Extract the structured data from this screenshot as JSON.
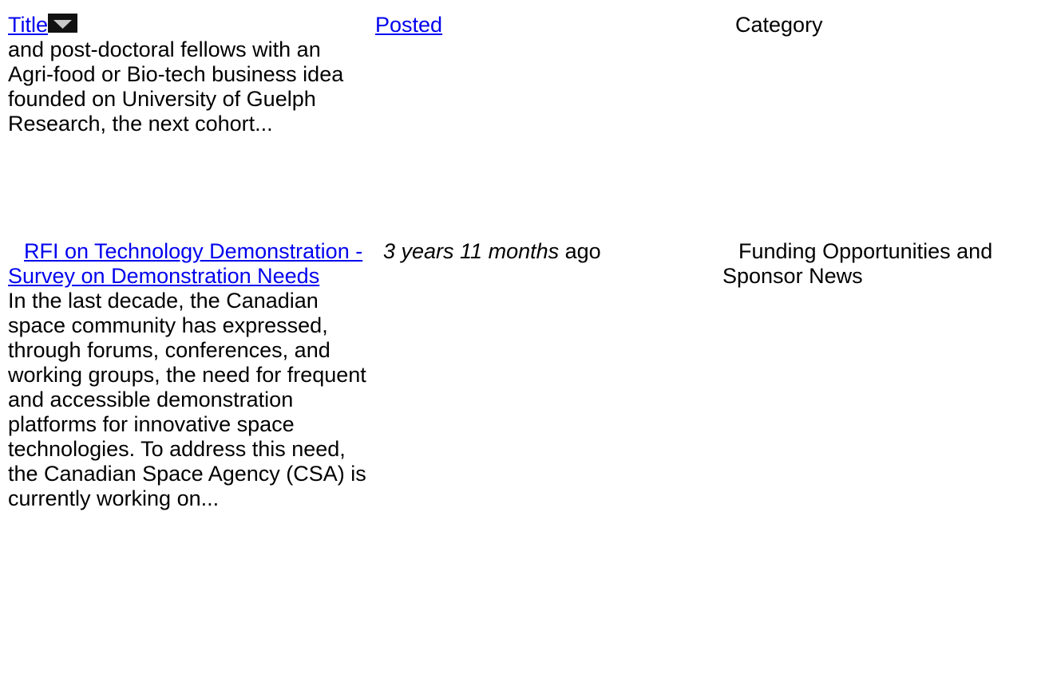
{
  "table": {
    "headers": {
      "title": "Title",
      "posted": "Posted",
      "category": "Category"
    },
    "sort_icon": "sort-descending-icon",
    "rows": [
      {
        "teaser": "and post-doctoral fellows with an Agri-food or Bio-tech business idea founded on University of Guelph Research, the next cohort..."
      },
      {
        "title": "RFI on Technology Demonstration - Survey on Demonstration Needs",
        "teaser": "In the last decade, the Canadian space community has expressed, through forums, conferences, and working groups, the need for frequent and accessible demonstration platforms for innovative space technologies. To address this need, the Canadian Space Agency (CSA) is currently working on...",
        "posted_age": "3 years 11 months",
        "posted_suffix": " ago",
        "category": "Funding Opportunities and Sponsor News"
      }
    ]
  }
}
